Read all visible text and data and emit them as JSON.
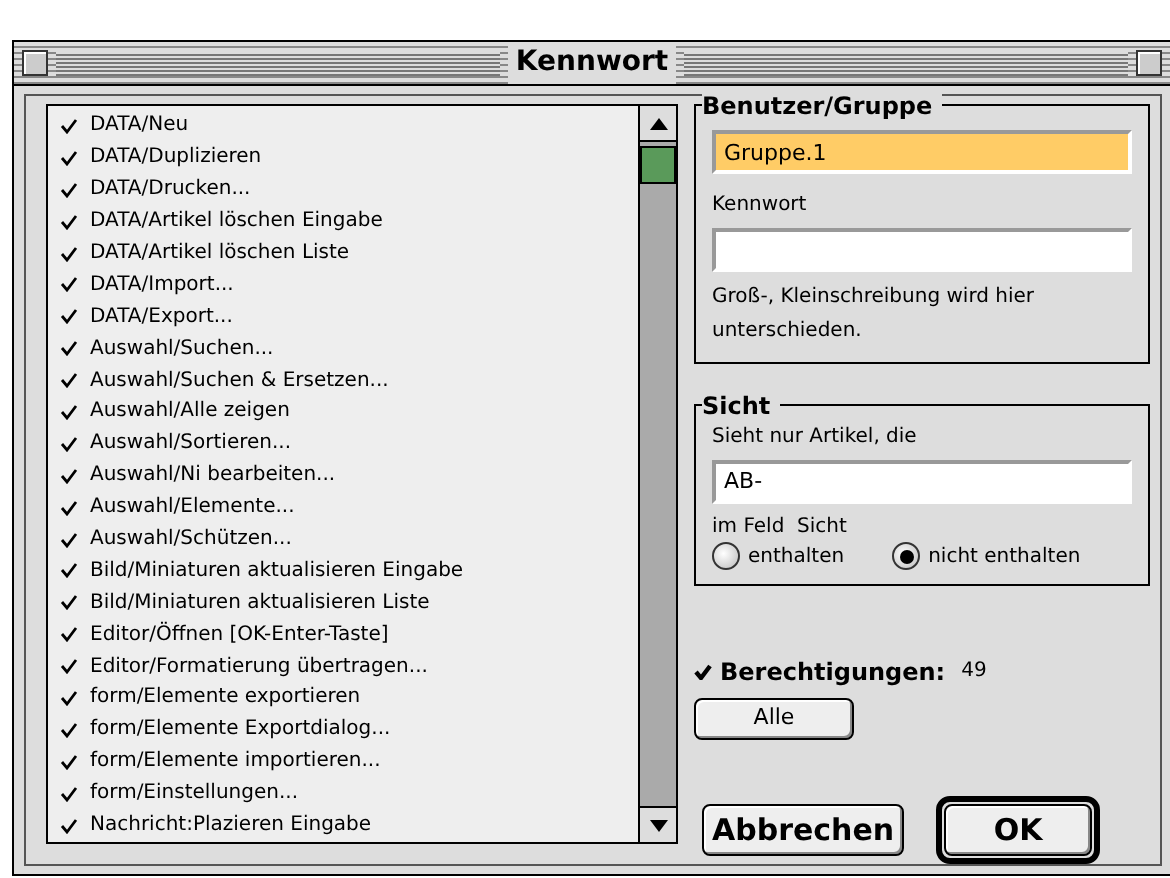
{
  "window": {
    "title": "Kennwort"
  },
  "permissions": [
    {
      "label": "DATA/Neu",
      "checked": true
    },
    {
      "label": "DATA/Duplizieren",
      "checked": true
    },
    {
      "label": "DATA/Drucken...",
      "checked": true
    },
    {
      "label": "DATA/Artikel löschen Eingabe",
      "checked": true
    },
    {
      "label": "DATA/Artikel löschen Liste",
      "checked": true
    },
    {
      "label": "DATA/Import...",
      "checked": true
    },
    {
      "label": "DATA/Export...",
      "checked": true
    },
    {
      "label": "Auswahl/Suchen...",
      "checked": true
    },
    {
      "label": "Auswahl/Suchen & Ersetzen...",
      "checked": true
    },
    {
      "label": "Auswahl/Alle zeigen",
      "checked": true
    },
    {
      "label": "Auswahl/Sortieren...",
      "checked": true
    },
    {
      "label": "Auswahl/Ni bearbeiten...",
      "checked": true
    },
    {
      "label": "Auswahl/Elemente...",
      "checked": true
    },
    {
      "label": "Auswahl/Schützen...",
      "checked": true
    },
    {
      "label": "Bild/Miniaturen aktualisieren Eingabe",
      "checked": true
    },
    {
      "label": "Bild/Miniaturen aktualisieren Liste",
      "checked": true
    },
    {
      "label": "Editor/Öffnen [OK-Enter-Taste]",
      "checked": true
    },
    {
      "label": "Editor/Formatierung übertragen...",
      "checked": true
    },
    {
      "label": "form/Elemente exportieren",
      "checked": true
    },
    {
      "label": "form/Elemente Exportdialog...",
      "checked": true
    },
    {
      "label": "form/Elemente importieren...",
      "checked": true
    },
    {
      "label": "form/Einstellungen...",
      "checked": true
    },
    {
      "label": "Nachricht:Plazieren Eingabe",
      "checked": true
    }
  ],
  "user_group": {
    "title": "Benutzer/Gruppe",
    "name_value": "Gruppe.1",
    "password_label": "Kennwort",
    "hint": "Groß-, Kleinschreibung wird hier unterschieden."
  },
  "view": {
    "title": "Sicht",
    "prompt": "Sieht nur Artikel, die",
    "value": "AB-",
    "field_label": "im Feld  Sicht",
    "options": [
      {
        "label": "enthalten",
        "selected": false
      },
      {
        "label": "nicht enthalten",
        "selected": true
      }
    ]
  },
  "rights": {
    "checked": true,
    "label": "Berechtigungen:",
    "count": "49",
    "all_button": "Alle"
  },
  "buttons": [
    {
      "label": "Abbrechen",
      "kind": "normal"
    },
    {
      "label": "OK",
      "kind": "default"
    }
  ]
}
